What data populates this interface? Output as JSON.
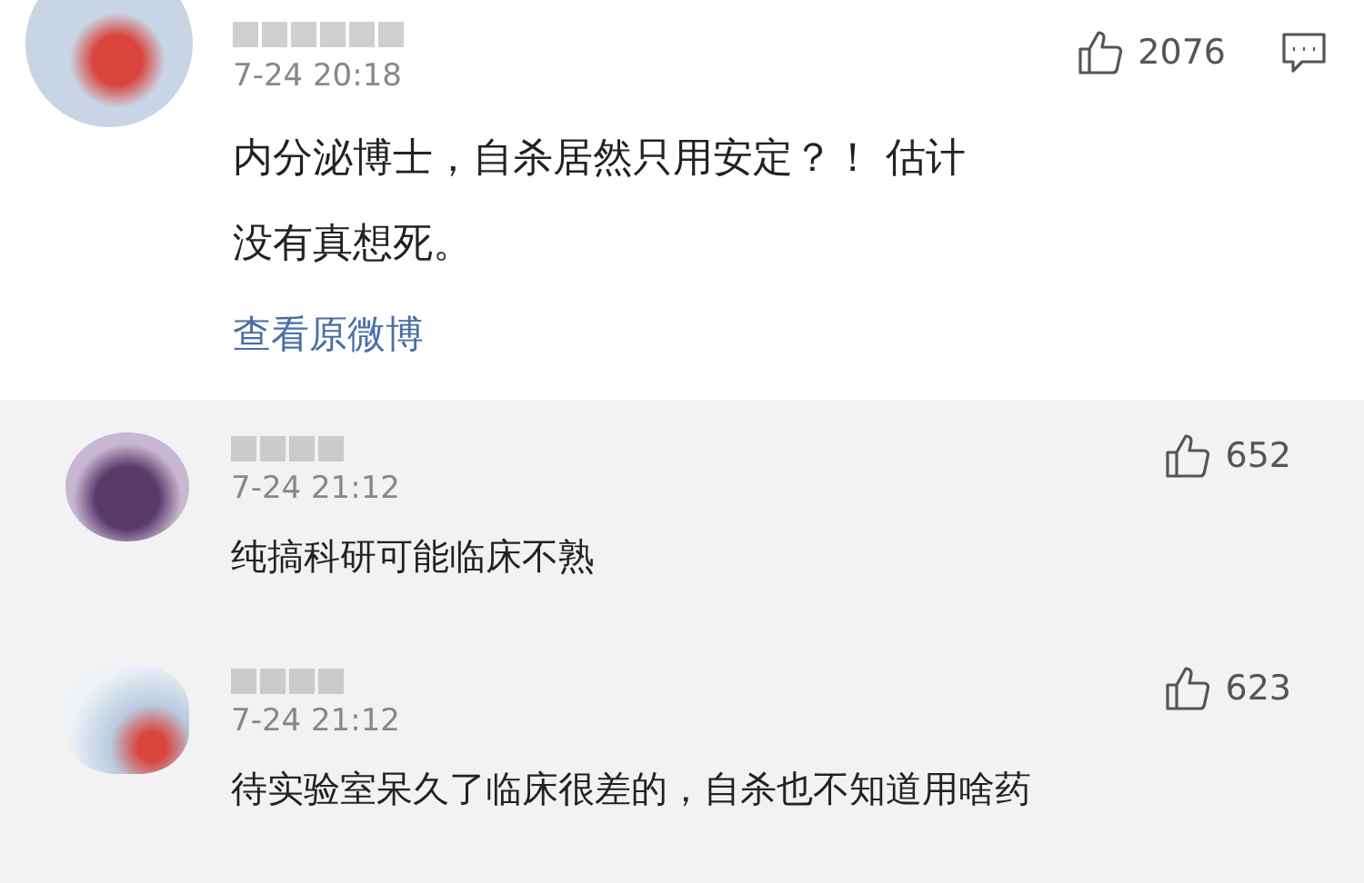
{
  "comment": {
    "time": "7-24 20:18",
    "likes": "2076",
    "text": "内分泌博士，自杀居然只用安定？！ 估计没有真想死。",
    "link": "查看原微博"
  },
  "replies": [
    {
      "time": "7-24 21:12",
      "likes": "652",
      "text": "纯搞科研可能临床不熟"
    },
    {
      "time": "7-24 21:12",
      "likes": "623",
      "text": "待实验室呆久了临床很差的，自杀也不知道用啥药"
    }
  ]
}
